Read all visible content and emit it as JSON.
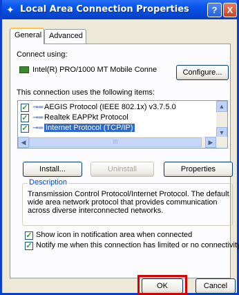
{
  "window": {
    "title": "Local Area Connection Properties",
    "help_label": "?",
    "close_label": "X"
  },
  "tabs": [
    {
      "label": "General",
      "active": true
    },
    {
      "label": "Advanced",
      "active": false
    }
  ],
  "general": {
    "connect_using_label": "Connect using:",
    "adapter_name": "Intel(R) PRO/1000 MT Mobile Conne",
    "configure_label": "Configure...",
    "items_label": "This connection uses the following items:",
    "items": [
      {
        "label": "AEGIS Protocol (IEEE 802.1x) v3.7.5.0",
        "checked": true,
        "selected": false
      },
      {
        "label": "Realtek EAPPkt Protocol",
        "checked": true,
        "selected": false
      },
      {
        "label": "Internet Protocol (TCP/IP)",
        "checked": true,
        "selected": true
      }
    ],
    "scroll_thumb_grip": "III",
    "install_label": "Install...",
    "uninstall_label": "Uninstall",
    "properties_label": "Properties",
    "description_title": "Description",
    "description_text": "Transmission Control Protocol/Internet Protocol. The default wide area network protocol that provides communication across diverse interconnected networks.",
    "show_icon_label": "Show icon in notification area when connected",
    "show_icon_checked": true,
    "notify_label": "Notify me when this connection has limited or no connectivity",
    "notify_checked": true
  },
  "footer": {
    "ok_label": "OK",
    "cancel_label": "Cancel"
  },
  "colors": {
    "titlebar": "#0548d6",
    "selection": "#316ac5",
    "highlight_box": "#d40000"
  }
}
